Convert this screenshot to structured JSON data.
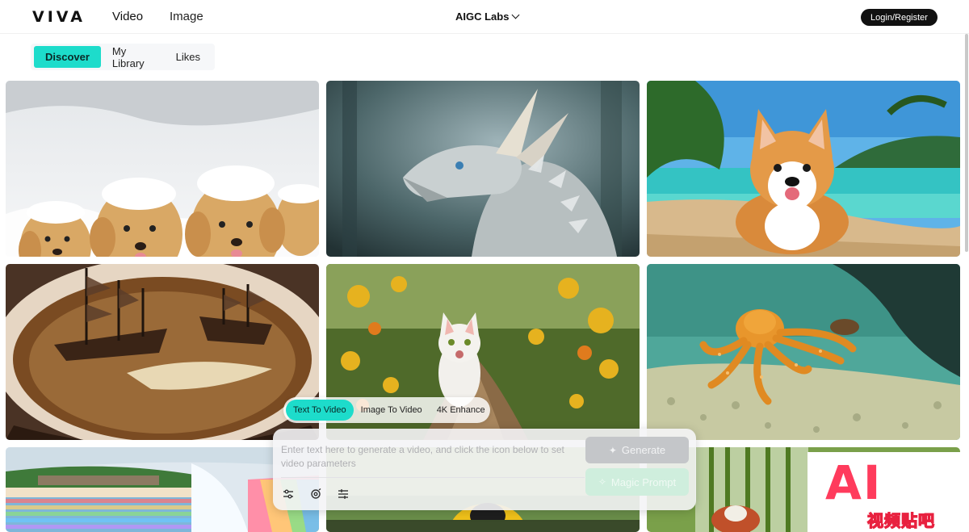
{
  "header": {
    "logo": "VIVA",
    "nav": {
      "video": "Video",
      "image": "Image"
    },
    "center_menu": "AIGC Labs",
    "login": "Login/Register"
  },
  "tabs": [
    "Discover",
    "My Library",
    "Likes"
  ],
  "gallery": [
    {
      "subject": "puppies in snow"
    },
    {
      "subject": "white dragon"
    },
    {
      "subject": "corgi on beach"
    },
    {
      "subject": "ships in coffee"
    },
    {
      "subject": "cat on path"
    },
    {
      "subject": "orange octopus"
    },
    {
      "subject": "rainbow waterfall"
    },
    {
      "subject": "person in yellow"
    },
    {
      "subject": "red panda in bamboo"
    }
  ],
  "modes": [
    "Text To Video",
    "Image To Video",
    "4K Enhance"
  ],
  "prompt": {
    "placeholder": "Enter text here to generate a video, and click the icon below to set video parameters",
    "icons": [
      "sliders-icon",
      "camera-motion-icon",
      "adjust-icon"
    ]
  },
  "buttons": {
    "generate": "Generate",
    "magic_prompt": "Magic Prompt"
  },
  "watermark": {
    "big": "AI",
    "small": "视频贴吧"
  },
  "colors": {
    "accent": "#1ddccb",
    "login_bg": "#111111",
    "watermark": "#ff3b5c"
  }
}
